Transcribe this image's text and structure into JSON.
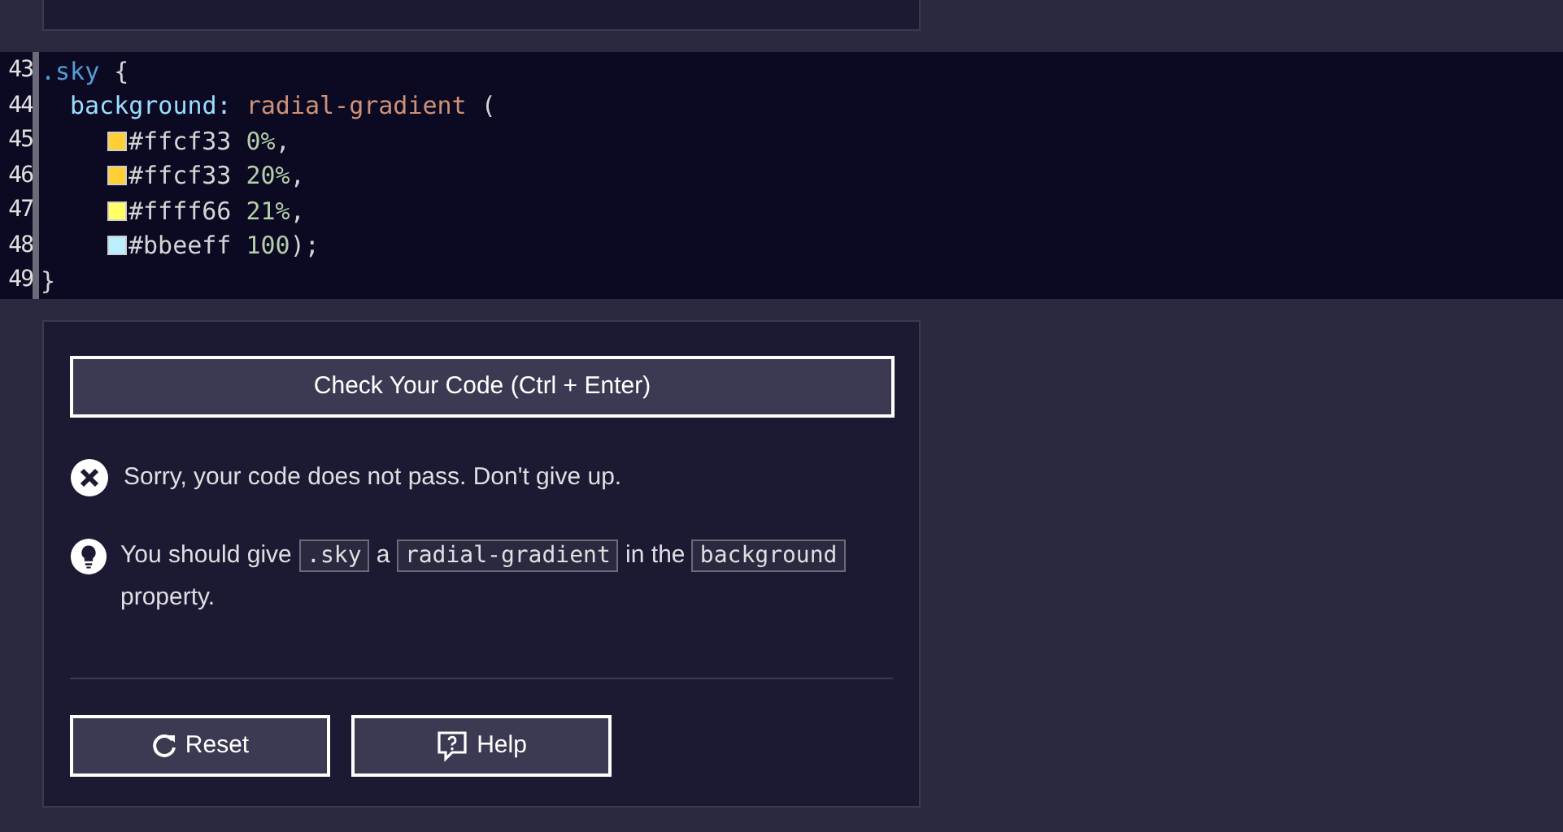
{
  "editor": {
    "lines": [
      {
        "number": "43",
        "kind": "rule",
        "tokens": [
          {
            "kind": "selector",
            "text": ".sky"
          },
          {
            "kind": "punct",
            "text": " {"
          }
        ]
      },
      {
        "number": "44",
        "kind": "declaration",
        "tokens": [
          {
            "kind": "property",
            "text": "background:"
          },
          {
            "kind": "function",
            "text": " radial-gradient"
          },
          {
            "kind": "punct",
            "text": " ("
          }
        ]
      },
      {
        "number": "45",
        "kind": "value",
        "color": "#ffcf33",
        "tokens": [
          {
            "kind": "punct",
            "text": "#ffcf33 "
          },
          {
            "kind": "number",
            "text": "0%"
          },
          {
            "kind": "punct",
            "text": ","
          }
        ]
      },
      {
        "number": "46",
        "kind": "value",
        "color": "#ffcf33",
        "tokens": [
          {
            "kind": "punct",
            "text": "#ffcf33 "
          },
          {
            "kind": "number",
            "text": "20%"
          },
          {
            "kind": "punct",
            "text": ","
          }
        ]
      },
      {
        "number": "47",
        "kind": "value",
        "color": "#ffff66",
        "tokens": [
          {
            "kind": "punct",
            "text": "#ffff66 "
          },
          {
            "kind": "number",
            "text": "21%"
          },
          {
            "kind": "punct",
            "text": ","
          }
        ]
      },
      {
        "number": "48",
        "kind": "value",
        "color": "#bbeeff",
        "tokens": [
          {
            "kind": "punct",
            "text": "#bbeeff "
          },
          {
            "kind": "number",
            "text": "100"
          },
          {
            "kind": "punct",
            "text": ");"
          }
        ]
      },
      {
        "number": "49",
        "kind": "rule",
        "tokens": [
          {
            "kind": "punct",
            "text": "}"
          }
        ]
      }
    ]
  },
  "check_button": "Check Your Code (Ctrl + Enter)",
  "result": {
    "message": "Sorry, your code does not pass. Don't give up."
  },
  "hint": [
    {
      "kind": "text",
      "text": "You should give "
    },
    {
      "kind": "code",
      "text": ".sky"
    },
    {
      "kind": "text",
      "text": " a "
    },
    {
      "kind": "code",
      "text": "radial-gradient"
    },
    {
      "kind": "text",
      "text": " in the "
    },
    {
      "kind": "code",
      "text": "background"
    },
    {
      "kind": "text",
      "text": " property."
    }
  ],
  "buttons": [
    {
      "kind": "reset",
      "label": "Reset"
    },
    {
      "kind": "help",
      "label": "Help"
    }
  ]
}
